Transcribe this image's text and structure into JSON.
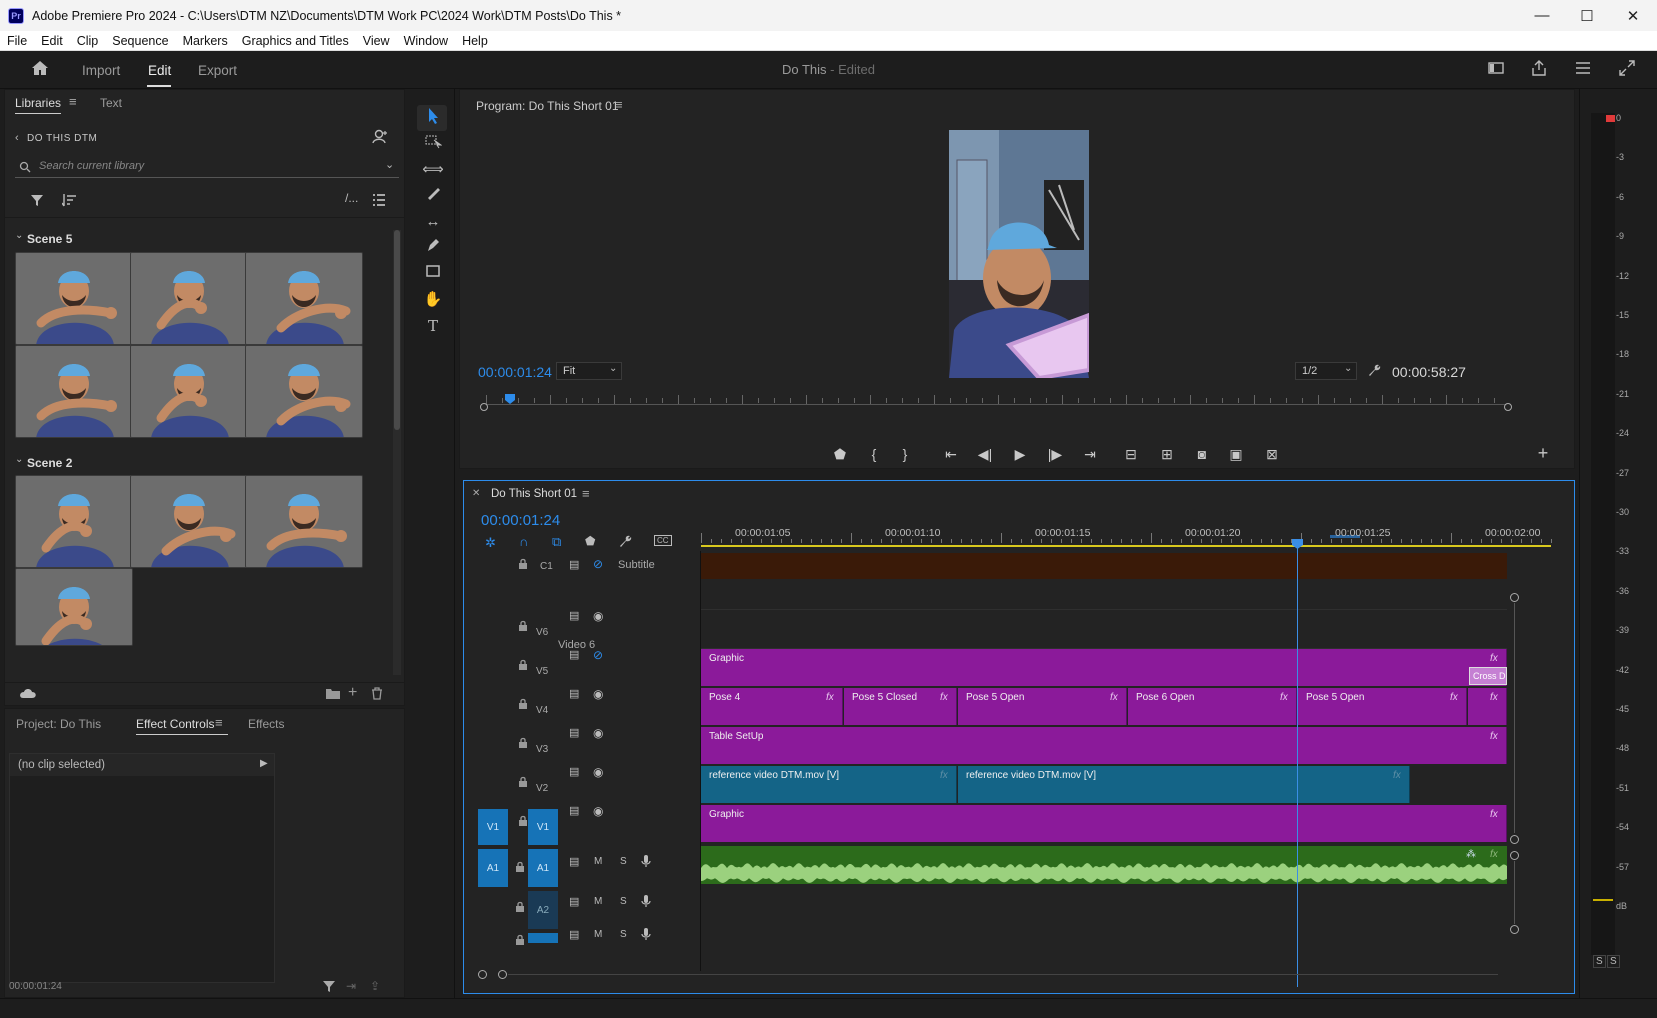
{
  "window": {
    "app_icon": "Pr",
    "title": "Adobe Premiere Pro 2024 - C:\\Users\\DTM NZ\\Documents\\DTM Work PC\\2024 Work\\DTM Posts\\Do This *",
    "minimize": "—",
    "maximize": "☐",
    "close": "✕"
  },
  "menu": [
    "File",
    "Edit",
    "Clip",
    "Sequence",
    "Markers",
    "Graphics and Titles",
    "View",
    "Window",
    "Help"
  ],
  "header": {
    "tabs": [
      "Import",
      "Edit",
      "Export"
    ],
    "active_tab": "Edit",
    "project": "Do This",
    "edited": " - Edited"
  },
  "libraries": {
    "tabs": [
      "Libraries",
      "Text"
    ],
    "library_name": "DO THIS DTM",
    "search_placeholder": "Search current library",
    "scenes": [
      {
        "label": "Scene 5",
        "count": 6
      },
      {
        "label": "Scene 2",
        "count": 4
      }
    ]
  },
  "bottom_left": {
    "tabs": [
      "Project: Do This",
      "Effect Controls",
      "Effects"
    ],
    "active_tab": "Effect Controls",
    "no_clip": "(no clip selected)",
    "timecode": "00:00:01:24"
  },
  "program": {
    "title": "Program: Do This Short 01",
    "timecode": "00:00:01:24",
    "fit": "Fit",
    "resolution": "1/2",
    "duration": "00:00:58:27"
  },
  "timeline": {
    "sequence": "Do This Short 01",
    "timecode": "00:00:01:24",
    "ruler": [
      "00:00:01:05",
      "00:00:01:10",
      "00:00:01:15",
      "00:00:01:20",
      "00:00:01:25",
      "00:00:02:00"
    ],
    "subtitle_label": "Subtitle",
    "tracks": {
      "c1": "C1",
      "v6": "V6",
      "v6_name": "Video 6",
      "v5": "V5",
      "v4": "V4",
      "v3": "V3",
      "v2": "V2",
      "v1": "V1",
      "a1": "A1",
      "a2": "A2",
      "src_v1": "V1",
      "src_a1": "A1",
      "mute": "M",
      "solo": "S"
    },
    "clips": {
      "v5_graphic": "Graphic",
      "v5_transition": "Cross Dis",
      "v4_pose4": "Pose 4",
      "v4_pose5_closed": "Pose 5 Closed",
      "v4_pose5_open_a": "Pose 5 Open",
      "v4_pose6_open": "Pose 6 Open",
      "v4_pose5_open_b": "Pose 5 Open",
      "v3_table": "Table SetUp",
      "v2_ref_a": "reference video DTM.mov [V]",
      "v2_ref_b": "reference video DTM.mov [V]",
      "v1_graphic": "Graphic",
      "fx": "fx"
    }
  },
  "audio_meter": {
    "labels": [
      "0",
      "-3",
      "-6",
      "-9",
      "-12",
      "-15",
      "-18",
      "-21",
      "-24",
      "-27",
      "-30",
      "-33",
      "-36",
      "-39",
      "-42",
      "-45",
      "-48",
      "-51",
      "-54",
      "-57",
      "dB"
    ],
    "solo_left": "S",
    "solo_right": "S"
  },
  "colors": {
    "accent_blue": "#2d8ceb",
    "clip_purple": "#8b1a9a",
    "clip_teal": "#146487",
    "audio_green": "#2c6b1b",
    "subtitle_brown": "#3a1a08",
    "playhead": "#3a8ee6"
  }
}
